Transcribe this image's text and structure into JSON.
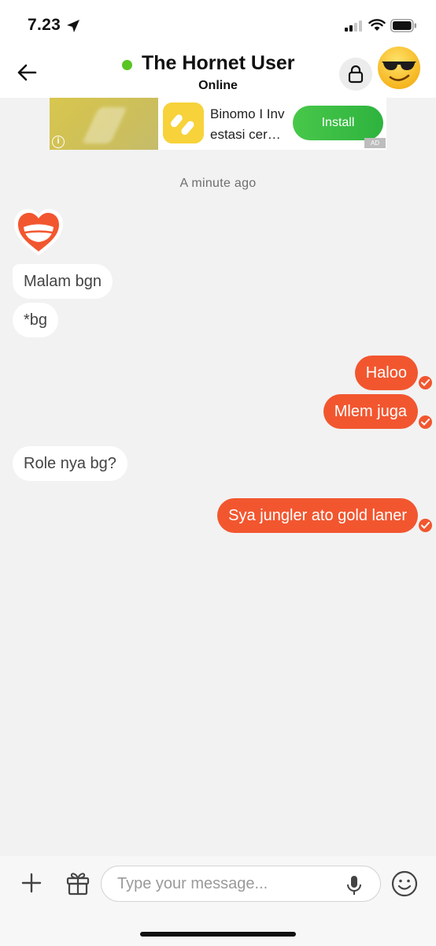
{
  "status_bar": {
    "time": "7.23",
    "icons": [
      "location-arrow-icon",
      "cellular-signal-icon",
      "wifi-icon",
      "battery-icon"
    ]
  },
  "header": {
    "back_icon": "arrow-left-icon",
    "contact_name": "The Hornet User",
    "contact_status": "Online",
    "status_color": "#58c524",
    "lock_icon": "lock-icon",
    "avatar": "sunglasses-emoji-avatar"
  },
  "ad": {
    "text": "Binomo I Inv estasi cer…",
    "install_label": "Install",
    "badge": "AD",
    "info_icon": "info-icon"
  },
  "chat": {
    "timestamp": "A minute ago",
    "sticker": "heart-smile-sticker",
    "messages": [
      {
        "from": "them",
        "text": "Malam bgn"
      },
      {
        "from": "them",
        "text": "*bg"
      },
      {
        "from": "me",
        "text": "Haloo",
        "read": true
      },
      {
        "from": "me",
        "text": "Mlem juga",
        "read": true
      },
      {
        "from": "them",
        "text": "Role nya bg?"
      },
      {
        "from": "me",
        "text": "Sya jungler ato gold laner",
        "read": true
      }
    ],
    "outgoing_color": "#f2562f",
    "incoming_color": "#ffffff"
  },
  "input_bar": {
    "placeholder": "Type your message...",
    "icons": [
      "plus-icon",
      "gift-icon",
      "microphone-icon",
      "emoji-icon"
    ]
  }
}
